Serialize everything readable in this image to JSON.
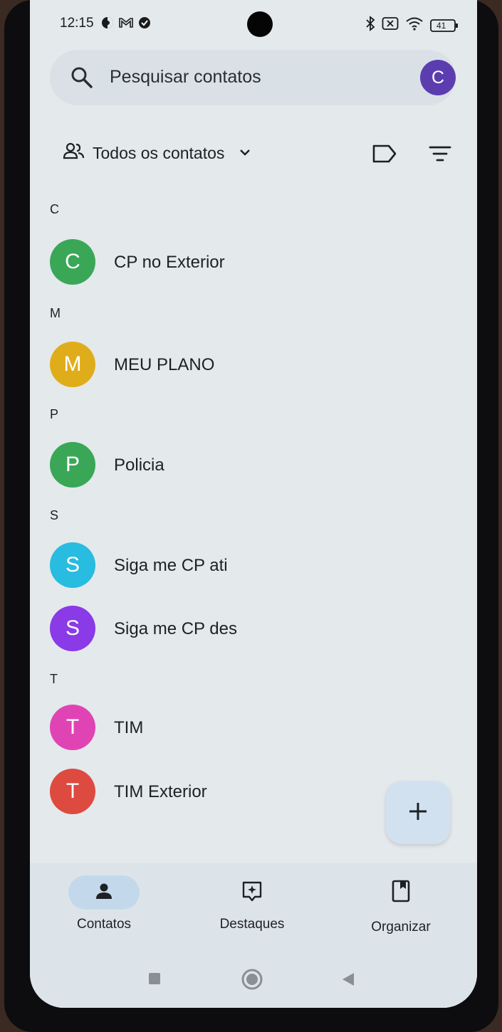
{
  "status_bar": {
    "time": "12:15",
    "left_icons": [
      "data-saver-icon",
      "gmail-icon",
      "check-badge-icon"
    ],
    "right_icons": [
      "bluetooth-icon",
      "no-sim-icon",
      "wifi-icon",
      "battery-icon"
    ],
    "battery_level": "41"
  },
  "search": {
    "placeholder": "Pesquisar contatos",
    "profile_initial": "C",
    "profile_color": "#5c3db0"
  },
  "filter": {
    "account_label": "Todos os contatos"
  },
  "sections": [
    {
      "letter": "C",
      "contacts": [
        {
          "initial": "C",
          "name": "CP no Exterior",
          "color": "#3aa757"
        }
      ]
    },
    {
      "letter": "M",
      "contacts": [
        {
          "initial": "M",
          "name": "MEU PLANO",
          "color": "#e0ad1a"
        }
      ]
    },
    {
      "letter": "P",
      "contacts": [
        {
          "initial": "P",
          "name": "Policia",
          "color": "#3aa757"
        }
      ]
    },
    {
      "letter": "S",
      "contacts": [
        {
          "initial": "S",
          "name": "Siga me CP ati",
          "color": "#27bce0"
        },
        {
          "initial": "S",
          "name": "Siga me CP des",
          "color": "#8a3ae6"
        }
      ]
    },
    {
      "letter": "T",
      "contacts": [
        {
          "initial": "T",
          "name": "TIM",
          "color": "#e044b4"
        },
        {
          "initial": "T",
          "name": "TIM Exterior",
          "color": "#dc4a40"
        }
      ]
    }
  ],
  "bottom_nav": [
    {
      "label": "Contatos",
      "icon": "person-icon",
      "active": true
    },
    {
      "label": "Destaques",
      "icon": "highlights-icon",
      "active": false
    },
    {
      "label": "Organizar",
      "icon": "organize-icon",
      "active": false
    }
  ],
  "system_nav": [
    "recents-button",
    "home-button",
    "back-button"
  ]
}
